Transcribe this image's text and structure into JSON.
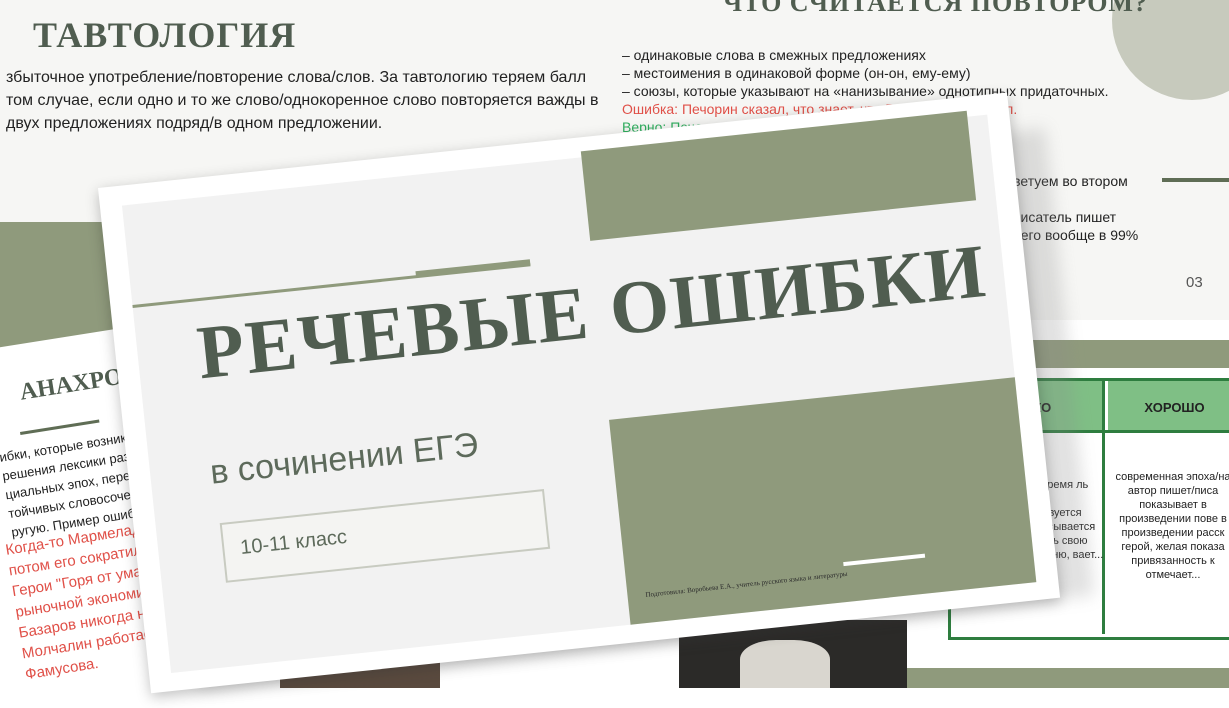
{
  "tautology_slide": {
    "title": "ТАВТОЛОГИЯ",
    "text": "збыточное употребление/повторение слова/слов. За тавтологию теряем балл том случае, если одно и то же слово/однокоренное слово повторяется важды в двух предложениях подряд/в одном предложении."
  },
  "repetition_slide": {
    "title": "ЧТО СЧИТАЕТСЯ ПОВТОРОМ?",
    "lines": [
      "– одинаковые слова в смежных предложениях",
      "– местоимения в одинаковой форме (он-он, ему-ему)",
      "– союзы, которые указывают на «нанизывание» однотипных придаточных."
    ],
    "error_line": "Ошибка: Печорин сказал, что знает, что Грушн... что предал.",
    "correct_line": "Верно: Печорин сказ... ницкого.",
    "tail_lines": [
      "я – советуем во втором",
      "",
      "ниях: писатель пишет",
      "ениях, его вообще в 99%"
    ],
    "page_number": "03"
  },
  "table_slide": {
    "col_bad": "ПЛОХО",
    "col_good": "ХОРОШО",
    "bad_text": "нное время ль пишет повествуется рассказывается показать свою сть к коню, вает...",
    "good_text": "современная эпоха/на автор пишет/писа показывает в произведении пове в произведении расск герой, желая показа привязанность к отмечает..."
  },
  "anachronism_slide": {
    "title": "АНАХРО",
    "text_lines": [
      "ибки, которые возника",
      "решения лексики разны",
      "циальных эпох, перене",
      "тойчивых словосочетан",
      "ругую. Пример ошибки:"
    ],
    "examples": [
      "Когда-то Мармеладов",
      "потом его сократили.",
      "Герои \"Горя от ума\" жи",
      "рыночной экономики",
      "Базаров никогда не зв",
      "Молчалин работает се",
      "Фамусова."
    ]
  },
  "main_slide": {
    "title": "РЕЧЕВЫЕ ОШИБКИ",
    "subtitle": "в сочинении ЕГЭ",
    "grade": "10-11 класс",
    "author": "Подготовила: Воробьева Е.А., учитель русского языка и литературы"
  },
  "colors": {
    "sage": "#8f9a7c",
    "title_dark": "#505d50",
    "error_red": "#e05048",
    "correct_green": "#2fae5e",
    "table_green": "#2e7d3f"
  }
}
